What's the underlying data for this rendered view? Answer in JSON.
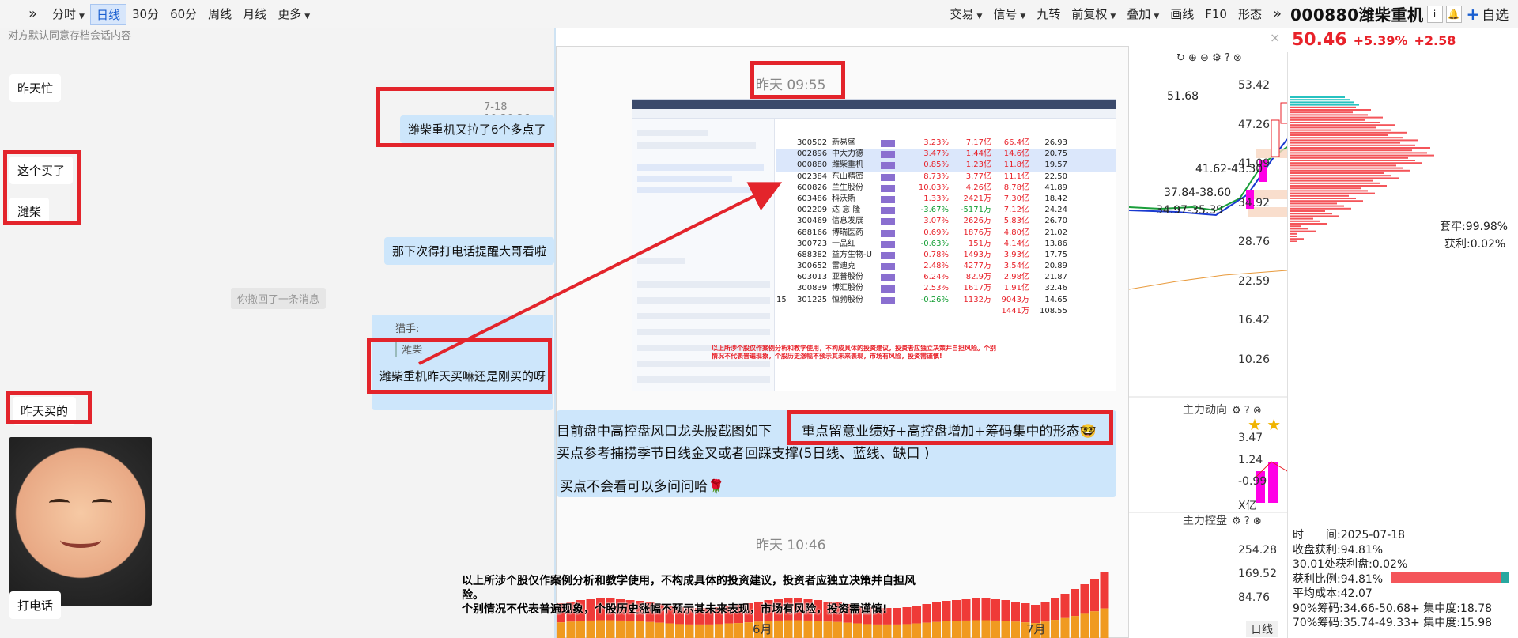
{
  "toolbar": {
    "left": [
      "分时",
      "日线",
      "30分",
      "60分",
      "周线",
      "月线",
      "更多"
    ],
    "right": [
      "交易",
      "信号",
      "九转",
      "前复权",
      "叠加",
      "画线",
      "F10",
      "形态"
    ]
  },
  "stock": {
    "code_name": "000880潍柴重机",
    "zixuan_label": "自选",
    "price": "50.46",
    "change_pct": "+5.39%",
    "change": "+2.58"
  },
  "chat": {
    "hint": "对方默认同意存档会话内容",
    "msgs": {
      "m1": "昨天忙",
      "m2": "潍柴重机又拉了6个多点了",
      "m2_time": "7-18 10:20:26",
      "m3": "这个买了",
      "m4": "潍柴",
      "m5": "那下次得打电话提醒大哥看啦",
      "m6": "你撤回了一条消息",
      "m7_quote_name": "猫手:",
      "m7_quote_text": "潍柴",
      "m7": "潍柴重机昨天买嘛还是刚买的呀",
      "m8": "昨天买的",
      "m9": "打电话"
    }
  },
  "screenshot": {
    "time1": "昨天 09:55",
    "time2": "昨天 10:46",
    "rows": [
      {
        "no": "",
        "code": "300502",
        "name": "新易盛",
        "pct": "3.23%",
        "amt": "7.17亿",
        "flow": "66.4亿",
        "pe": "26.93",
        "hl": false
      },
      {
        "no": "",
        "code": "002896",
        "name": "中大力德",
        "pct": "3.47%",
        "amt": "1.44亿",
        "flow": "14.6亿",
        "pe": "20.75",
        "hl": true
      },
      {
        "no": "",
        "code": "000880",
        "name": "潍柴重机",
        "pct": "0.85%",
        "amt": "1.23亿",
        "flow": "11.8亿",
        "pe": "19.57",
        "hl": true
      },
      {
        "no": "",
        "code": "002384",
        "name": "东山精密",
        "pct": "8.73%",
        "amt": "3.77亿",
        "flow": "11.1亿",
        "pe": "22.50",
        "hl": false
      },
      {
        "no": "",
        "code": "600826",
        "name": "兰生股份",
        "pct": "10.03%",
        "amt": "4.26亿",
        "flow": "8.78亿",
        "pe": "41.89",
        "hl": false
      },
      {
        "no": "",
        "code": "603486",
        "name": "科沃斯",
        "pct": "1.33%",
        "amt": "2421万",
        "flow": "7.30亿",
        "pe": "18.42",
        "hl": false
      },
      {
        "no": "",
        "code": "002209",
        "name": "达 意 隆",
        "pct": "-3.67%",
        "amt": "-5171万",
        "flow": "7.12亿",
        "pe": "24.24",
        "hl": false
      },
      {
        "no": "",
        "code": "300469",
        "name": "信息发展",
        "pct": "3.07%",
        "amt": "2626万",
        "flow": "5.83亿",
        "pe": "26.70",
        "hl": false
      },
      {
        "no": "",
        "code": "688166",
        "name": "博瑞医药",
        "pct": "0.69%",
        "amt": "1876万",
        "flow": "4.80亿",
        "pe": "21.02",
        "hl": false
      },
      {
        "no": "",
        "code": "300723",
        "name": "一品红",
        "pct": "-0.63%",
        "amt": "151万",
        "flow": "4.14亿",
        "pe": "13.86",
        "hl": false
      },
      {
        "no": "",
        "code": "688382",
        "name": "益方生物-U",
        "pct": "0.78%",
        "amt": "1493万",
        "flow": "3.93亿",
        "pe": "17.75",
        "hl": false
      },
      {
        "no": "",
        "code": "300652",
        "name": "雷迪克",
        "pct": "2.48%",
        "amt": "4277万",
        "flow": "3.54亿",
        "pe": "20.89",
        "hl": false
      },
      {
        "no": "",
        "code": "603013",
        "name": "亚普股份",
        "pct": "6.24%",
        "amt": "82.9万",
        "flow": "2.98亿",
        "pe": "21.87",
        "hl": false
      },
      {
        "no": "",
        "code": "300839",
        "name": "博汇股份",
        "pct": "2.53%",
        "amt": "1617万",
        "flow": "1.91亿",
        "pe": "32.46",
        "hl": false
      },
      {
        "no": "15",
        "code": "301225",
        "name": "恒勃股份",
        "pct": "-0.26%",
        "amt": "1132万",
        "flow": "9043万",
        "pe": "14.65",
        "hl": false
      },
      {
        "no": "",
        "code": "",
        "name": "",
        "pct": "",
        "amt": "",
        "flow": "1441万",
        "pe": "108.55",
        "hl": false
      }
    ],
    "small_warning": "以上所涉个股仅作案例分析和教学使用，不构成具体的投资建议，投资者应独立决策并自担风险。个别情况不代表普遍现象，个股历史涨幅不预示其未来表现，市场有风险，投资需谨慎!",
    "msg_l1a": "目前盘中高控盘风口龙头股截图如下",
    "msg_l1b": "重点留意业绩好+高控盘增加+筹码集中的形态🤓",
    "msg_l2": "买点参考捕捞季节日线金叉或者回踩支撑(5日线、蓝线、缺口 )",
    "msg_l3": "买点不会看可以多问问哈🌹"
  },
  "chart": {
    "y_main": [
      "53.42",
      "47.26",
      "41.09",
      "34.92",
      "28.76",
      "22.59",
      "16.42",
      "10.26"
    ],
    "anno": [
      "51.68",
      "41.62-43.30",
      "37.84-38.60",
      "34.97-35.39"
    ],
    "panel1": "主力动向",
    "y_p1": [
      "3.47",
      "1.24",
      "-0.99",
      "X亿"
    ],
    "panel2": "主力控盘",
    "y_p2": [
      "254.28",
      "169.52",
      "84.76"
    ],
    "months": [
      "6月",
      "7月"
    ],
    "period": "日线"
  },
  "chip": {
    "taolao": "套牢:99.98%",
    "huoli": "获利:0.02%",
    "lines": [
      "时　　间:2025-07-18",
      "收盘获利:94.81%",
      "30.01处获利盘:0.02%",
      "获利比例:94.81%",
      "平均成本:42.07",
      "90%筹码:34.66-50.68+ 集中度:18.78",
      "70%筹码:35.74-49.33+ 集中度:15.98"
    ]
  },
  "warning": {
    "l1": "以上所涉个股仅作案例分析和教学使用，不构成具体的投资建议，投资者应独立决策并自担风险。",
    "l2": "个别情况不代表普遍现象，个股历史涨幅不预示其未来表现，市场有风险，投资需谨慎!"
  },
  "colors": {
    "red": "#e8222a",
    "blue_bubble": "#cde6fb",
    "accent": "#1a5fd0",
    "magenta": "#ff00e6"
  }
}
